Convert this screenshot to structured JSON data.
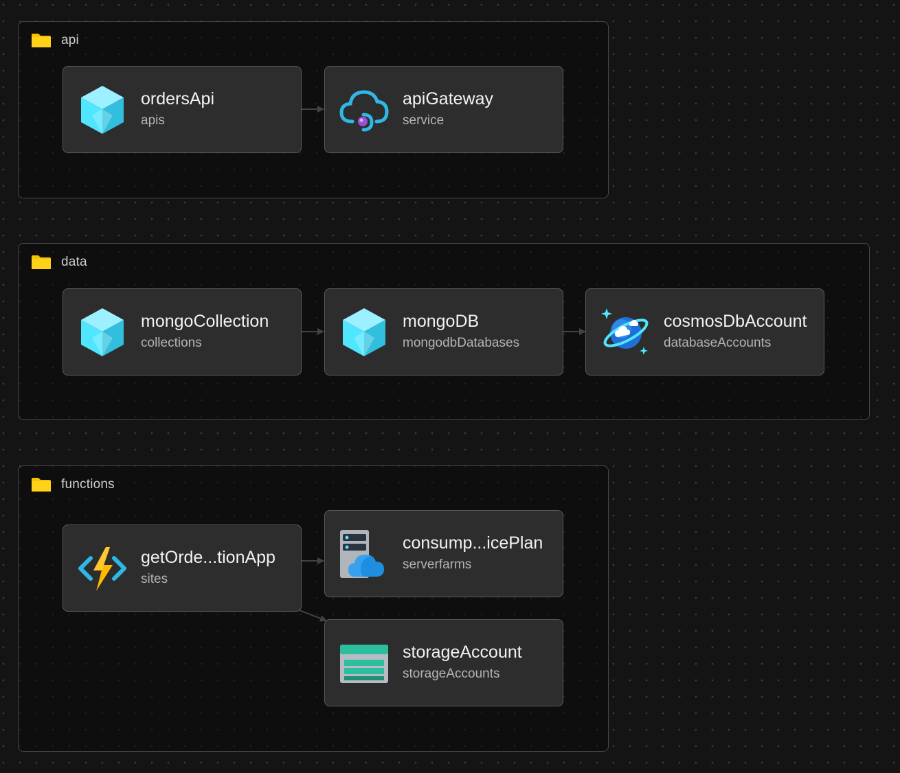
{
  "groups": [
    {
      "id": "api",
      "label": "api"
    },
    {
      "id": "data",
      "label": "data"
    },
    {
      "id": "functions",
      "label": "functions"
    }
  ],
  "nodes": {
    "ordersApi": {
      "title": "ordersApi",
      "subtitle": "apis",
      "icon": "cube-icon"
    },
    "apiGateway": {
      "title": "apiGateway",
      "subtitle": "service",
      "icon": "cloud-gateway-icon"
    },
    "mongoCollection": {
      "title": "mongoCollection",
      "subtitle": "collections",
      "icon": "cube-icon"
    },
    "mongoDB": {
      "title": "mongoDB",
      "subtitle": "mongodbDatabases",
      "icon": "cube-icon"
    },
    "cosmosDbAccount": {
      "title": "cosmosDbAccount",
      "subtitle": "databaseAccounts",
      "icon": "cosmos-planet-icon"
    },
    "getOrdersFunctionApp": {
      "title": "getOrde...tionApp",
      "subtitle": "sites",
      "icon": "function-bolt-icon"
    },
    "consumptionServicePlan": {
      "title": "consump...icePlan",
      "subtitle": "serverfarms",
      "icon": "server-cloud-icon"
    },
    "storageAccount": {
      "title": "storageAccount",
      "subtitle": "storageAccounts",
      "icon": "storage-icon"
    }
  },
  "edges": [
    {
      "from": "ordersApi",
      "to": "apiGateway"
    },
    {
      "from": "mongoCollection",
      "to": "mongoDB"
    },
    {
      "from": "mongoDB",
      "to": "cosmosDbAccount"
    },
    {
      "from": "getOrdersFunctionApp",
      "to": "consumptionServicePlan"
    },
    {
      "from": "getOrdersFunctionApp",
      "to": "storageAccount"
    }
  ],
  "colors": {
    "background": "#141414",
    "node_fill": "#2d2d2d",
    "node_border": "#5a5a5a",
    "group_border": "#4a4a4a",
    "edge": "#8a8a8a",
    "folder": "#f5c400",
    "azure_cyan": "#50e6ff",
    "azure_blue": "#1490df"
  }
}
